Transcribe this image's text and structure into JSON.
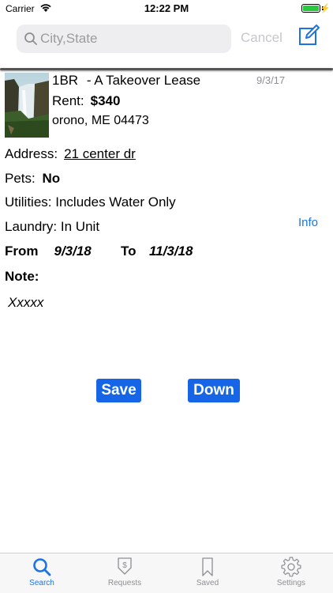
{
  "status_bar": {
    "carrier": "Carrier",
    "time": "12:22 PM"
  },
  "search": {
    "placeholder": "City,State",
    "cancel_label": "Cancel"
  },
  "listing": {
    "beds": "1BR",
    "title": "- A Takeover Lease",
    "date": "9/3/17",
    "rent_label": "Rent:",
    "rent_value": "$340",
    "location": "orono, ME 04473",
    "address_label": "Address:",
    "address_value": "21 center dr",
    "pets_label": "Pets:",
    "pets_value": "No",
    "utilities_label": "Utilities:",
    "utilities_value": "Includes Water Only",
    "laundry_label": "Laundry:",
    "laundry_value": "In Unit",
    "info_label": "Info",
    "from_label": "From",
    "from_value": "9/3/18",
    "to_label": "To",
    "to_value": "11/3/18",
    "note_label": "Note:",
    "note_text": "Xxxxx"
  },
  "actions": {
    "save_label": "Save",
    "down_label": "Down"
  },
  "tabs": [
    {
      "label": "Search",
      "icon": "search-icon",
      "active": true
    },
    {
      "label": "Requests",
      "icon": "requests-icon",
      "active": false
    },
    {
      "label": "Saved",
      "icon": "bookmark-icon",
      "active": false
    },
    {
      "label": "Settings",
      "icon": "gear-icon",
      "active": false
    }
  ],
  "colors": {
    "accent": "#1a73e8",
    "button": "#1565e6",
    "inactive_tab": "#8e8e93"
  }
}
